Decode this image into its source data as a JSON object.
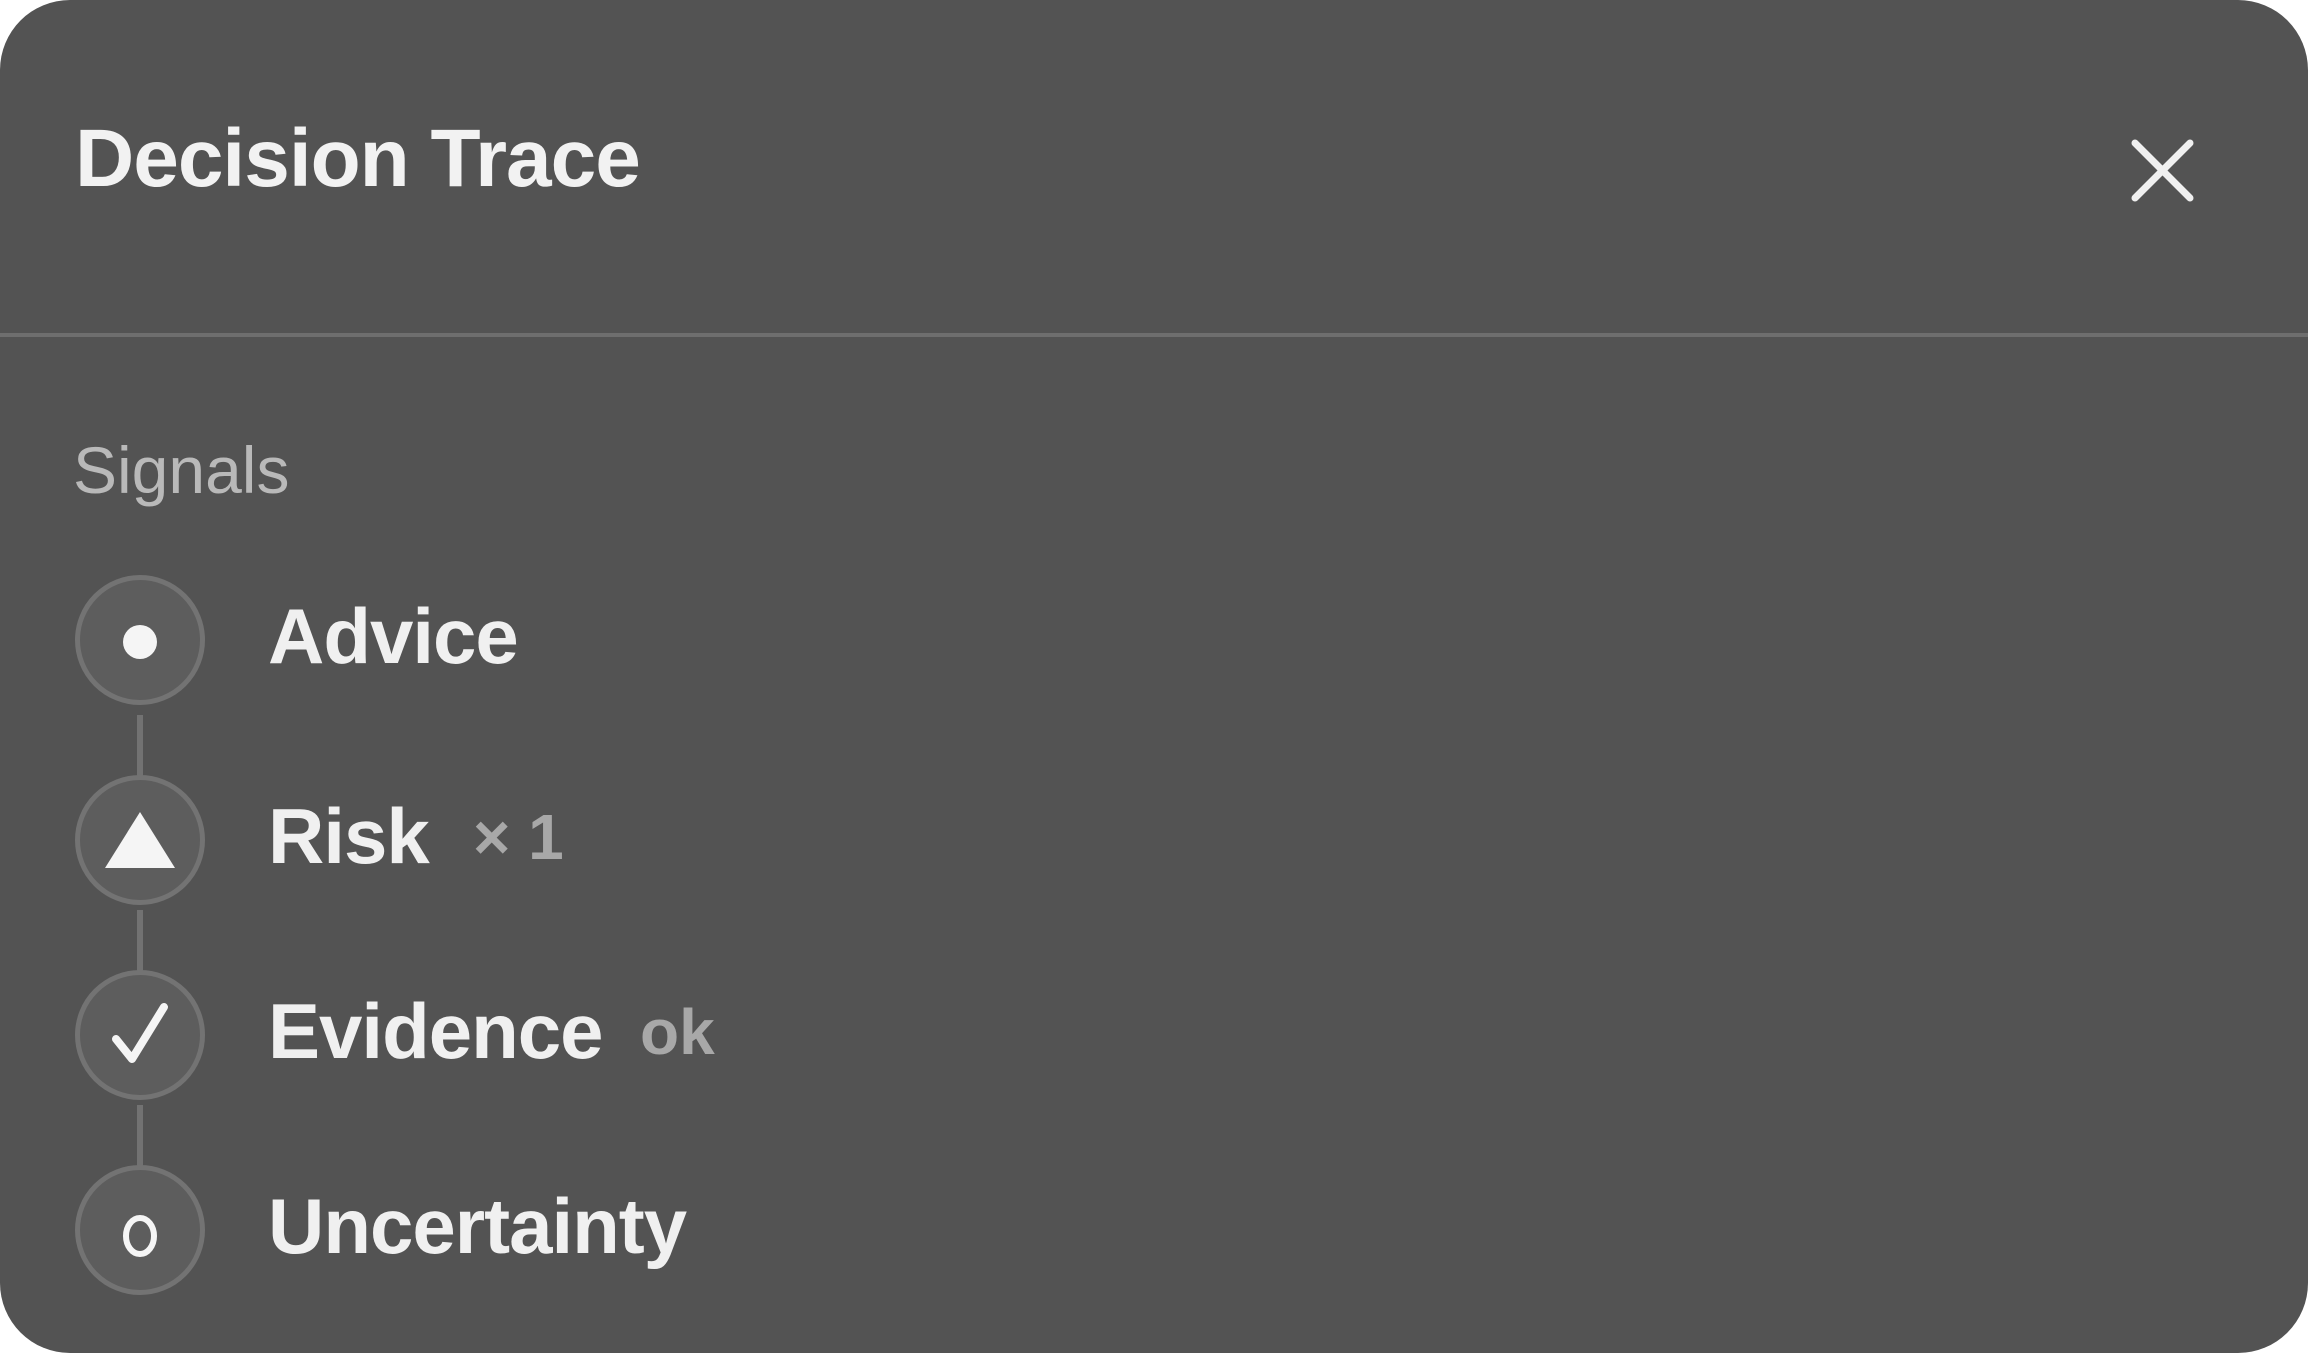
{
  "panel": {
    "title": "Decision Trace",
    "close_icon": "close-icon"
  },
  "signals": {
    "section_label": "Signals",
    "items": [
      {
        "label": "Advice",
        "meta": "",
        "icon": "dot-icon"
      },
      {
        "label": "Risk",
        "meta": "× 1",
        "icon": "triangle-warning-icon"
      },
      {
        "label": "Evidence",
        "meta": "ok",
        "icon": "checkmark-icon"
      },
      {
        "label": "Uncertainty",
        "meta": "",
        "icon": "hollow-circle-icon"
      }
    ]
  }
}
